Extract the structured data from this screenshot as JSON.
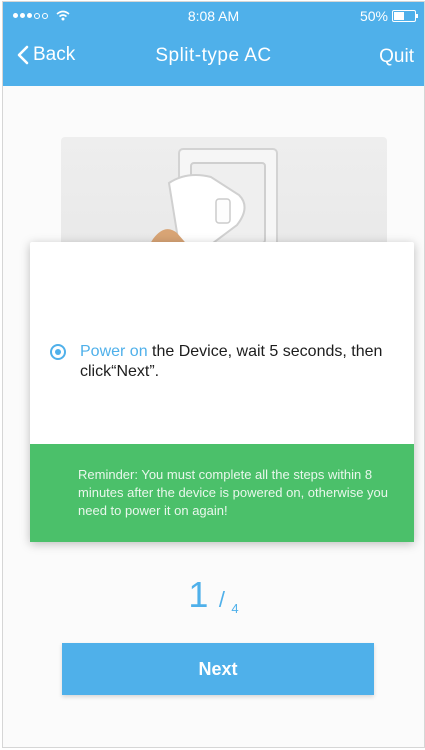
{
  "status_bar": {
    "time": "8:08 AM",
    "battery": "50%",
    "battery_level": 0.5
  },
  "nav": {
    "back_label": "Back",
    "title": "Split-type AC",
    "quit_label": "Quit"
  },
  "step": {
    "highlight": "Power on",
    "text": " the Device, wait 5 seconds, then click“Next”."
  },
  "reminder": "Reminder: You must complete all the steps within 8 minutes after the device is powered on, otherwise you need to power it on again!",
  "progress": {
    "current": "1",
    "separator": "/",
    "total": "4"
  },
  "next_label": "Next",
  "colors": {
    "primary": "#4fb0ea",
    "reminder_bg": "#4bc06a"
  },
  "icons": {
    "back": "chevron-left-icon",
    "wifi": "wifi-icon",
    "battery": "battery-icon",
    "radio": "radio-selected-icon"
  }
}
